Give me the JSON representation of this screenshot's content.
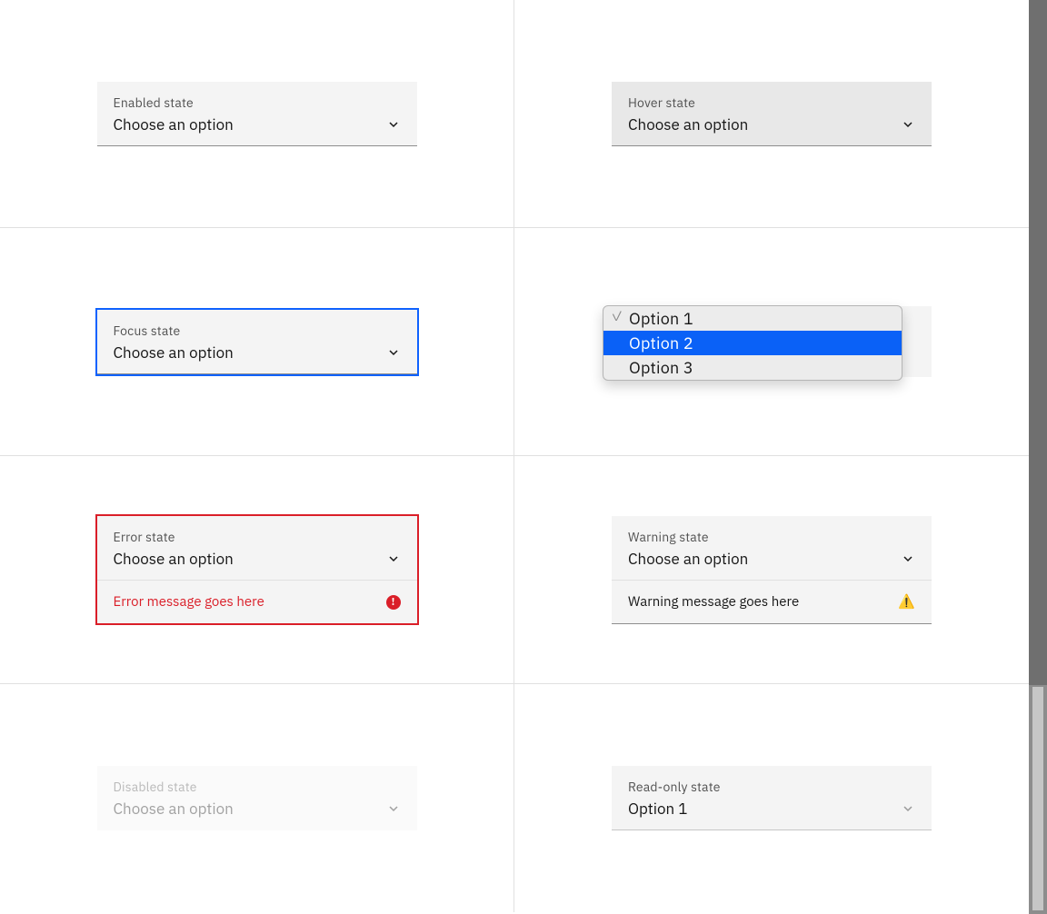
{
  "states": {
    "enabled": {
      "label": "Enabled state",
      "value": "Choose an option"
    },
    "hover": {
      "label": "Hover state",
      "value": "Choose an option"
    },
    "focus": {
      "label": "Focus state",
      "value": "Choose an option"
    },
    "open": {
      "options": [
        "Option 1",
        "Option 2",
        "Option 3"
      ],
      "selected_index": 0,
      "highlight_index": 1
    },
    "error": {
      "label": "Error state",
      "value": "Choose an option",
      "message": "Error message goes here"
    },
    "warning": {
      "label": "Warning state",
      "value": "Choose an option",
      "message": "Warning message goes here"
    },
    "disabled": {
      "label": "Disabled state",
      "value": "Choose an option"
    },
    "readonly": {
      "label": "Read-only state",
      "value": "Option 1"
    }
  },
  "icons": {
    "error_glyph": "!",
    "warning_glyph": "⚠️"
  },
  "colors": {
    "focus_border": "#0f62fe",
    "error_red": "#da1e28",
    "highlight_blue": "#0a61f7"
  }
}
